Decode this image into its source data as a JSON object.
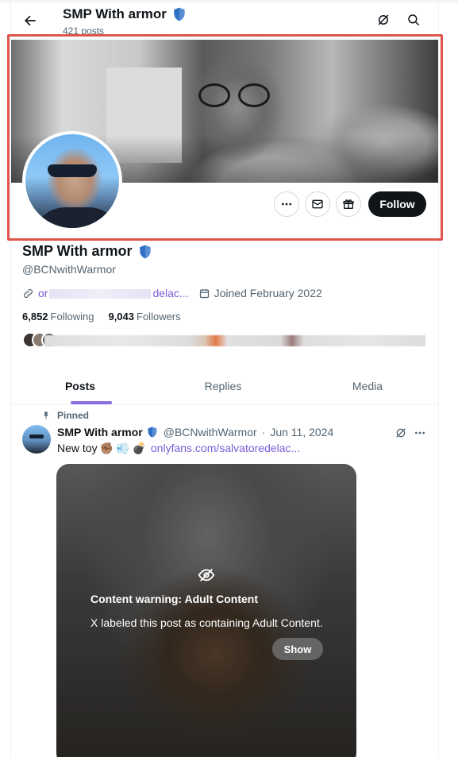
{
  "colors": {
    "accent": "#8a6fe0",
    "link": "#7a5bd6",
    "verified_badge": "#5a8fd6",
    "highlight": "#e0544c",
    "follow_button": "#0f1419"
  },
  "topbar": {
    "title": "SMP With armor",
    "post_count": "421 posts",
    "back_icon": "arrow-left-icon",
    "grok_icon": "grok-icon",
    "search_icon": "search-icon"
  },
  "header": {
    "actions": {
      "more_icon": "more-icon",
      "message_icon": "mail-icon",
      "subscribe_icon": "gift-icon",
      "follow_label": "Follow"
    }
  },
  "profile": {
    "name": "SMP With armor",
    "handle": "@BCNwithWarmor",
    "website_start": "or",
    "website_end": "delac...",
    "joined": "Joined February 2022",
    "following_count": "6,852",
    "following_label": "Following",
    "followers_count": "9,043",
    "followers_label": "Followers"
  },
  "tabs": [
    {
      "label": "Posts",
      "active": true
    },
    {
      "label": "Replies",
      "active": false
    },
    {
      "label": "Media",
      "active": false
    }
  ],
  "post": {
    "pinned_label": "Pinned",
    "author_name": "SMP With armor",
    "author_handle": "@BCNwithWarmor",
    "separator": "·",
    "date": "Jun 11, 2024",
    "text": "New toy",
    "emojis": [
      "✊🏽",
      "💨",
      "💣"
    ],
    "link": "onlyfans.com/salvatoredelac...",
    "content_warning": {
      "title": "Content warning: Adult Content",
      "description": "X labeled this post as containing Adult Content.",
      "show_label": "Show"
    }
  }
}
